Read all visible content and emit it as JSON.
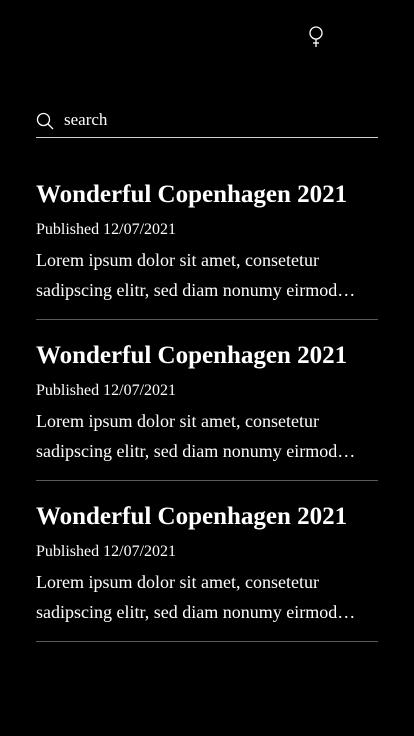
{
  "header": {
    "icon": "female-symbol-icon"
  },
  "search": {
    "icon": "search-icon",
    "placeholder": "search",
    "value": ""
  },
  "articles": [
    {
      "title": "Wonderful Copenhagen 2021",
      "date": "Published 12/07/2021",
      "excerpt": "Lorem ipsum dolor sit amet, consetetur sadipscing elitr, sed diam nonumy eirmod tempor invidunt ut labore et dolore magna aliquyam erat"
    },
    {
      "title": "Wonderful Copenhagen 2021",
      "date": "Published 12/07/2021",
      "excerpt": "Lorem ipsum dolor sit amet, consetetur sadipscing elitr, sed diam nonumy eirmod tempor invidunt ut labore et dolore magna aliquyam erat"
    },
    {
      "title": "Wonderful Copenhagen 2021",
      "date": "Published 12/07/2021",
      "excerpt": "Lorem ipsum dolor sit amet, consetetur sadipscing elitr, sed diam nonumy eirmod tempor invidunt ut labore et dolore magna aliquyam erat"
    }
  ],
  "colors": {
    "background": "#000000",
    "text": "#ffffff",
    "divider": "#5a5a5a"
  }
}
